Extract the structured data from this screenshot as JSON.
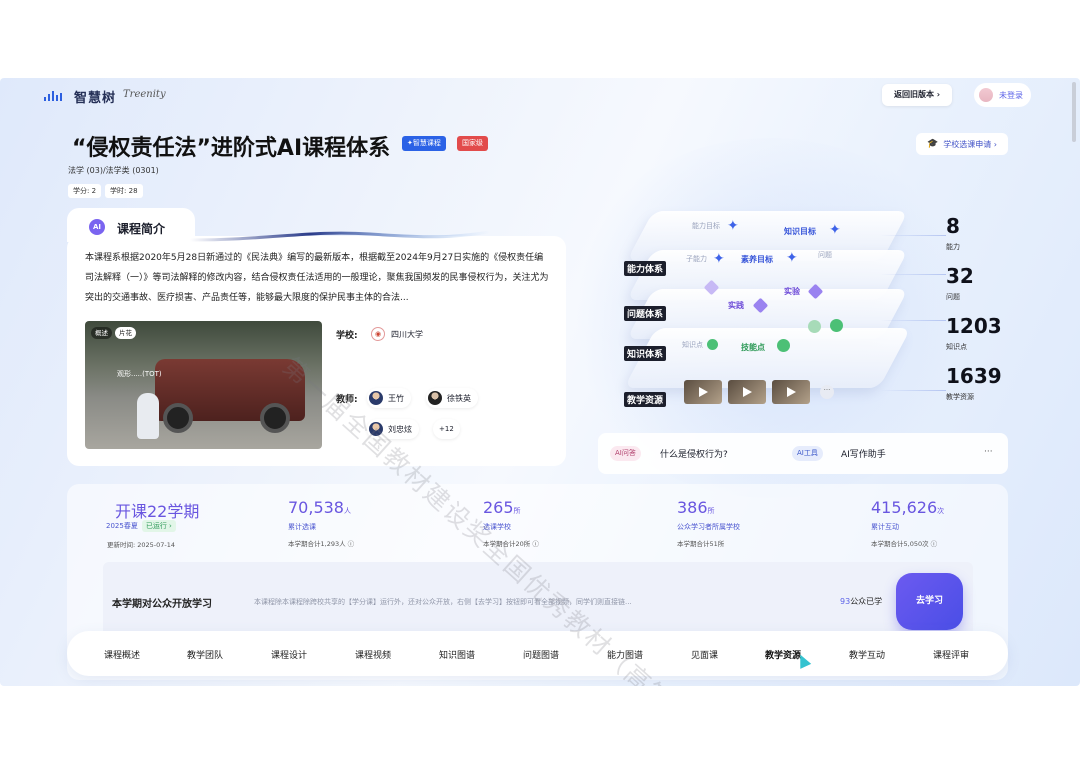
{
  "header": {
    "logo_text": "智慧树",
    "logo_sub": "Treenity",
    "old_version_label": "返回旧版本 ›",
    "login_label": "未登录"
  },
  "course": {
    "title": "“侵权责任法”进阶式AI课程体系",
    "tag_smart": "✦智慧课程",
    "tag_national": "国家级",
    "apply_label": "学校选课申请 ›",
    "subject": "法学 (03)/法学类 (0301)",
    "credit": "学分: 2",
    "hours": "学时: 28"
  },
  "intro": {
    "icon_text": "AI",
    "title": "课程简介",
    "description": "本课程系根据2020年5月28日新通过的《民法典》编写的最新版本，根据截至2024年9月27日实施的《侵权责任编司法解释（一）》等司法解释的修改内容，结合侵权责任法适用的一般理论，聚焦我国频发的民事侵权行为，关注尤为突出的交通事故、医疗损害、产品责任等，能够最大限度的保护民事主体的合法...",
    "video_chip_overview": "概述",
    "video_chip_trailer": "片花",
    "video_caption": "观形.....(TOT)",
    "school_label": "学校:",
    "school_name": "四川大学",
    "teacher_label": "教师:",
    "teachers": [
      "王竹",
      "徐铁英",
      "刘忠炫"
    ],
    "teachers_more": "+12"
  },
  "system": {
    "layers": [
      "能力体系",
      "问题体系",
      "知识体系",
      "教学资源"
    ],
    "nodes": {
      "ability_goal": "能力目标",
      "knowledge_goal": "知识目标",
      "sub_ability": "子能力",
      "quality_goal": "素养目标",
      "question": "问题",
      "practice": "实践",
      "experiment": "实验",
      "knowledge_point": "知识点",
      "skill_point": "技能点"
    },
    "more_resources": "···"
  },
  "metrics": [
    {
      "value": "8",
      "label": "能力"
    },
    {
      "value": "32",
      "label": "问题"
    },
    {
      "value": "1203",
      "label": "知识点"
    },
    {
      "value": "1639",
      "label": "教学资源"
    }
  ],
  "ai_bar": {
    "qa_chip": "AI问答",
    "qa_text": "什么是侵权行为?",
    "tool_chip": "AI工具",
    "tool_text": "AI写作助手",
    "more": "···"
  },
  "stats": {
    "semester": {
      "value": "开课22学期",
      "season": "2025春夏",
      "status": "已运行 ›",
      "updated": "更新时间: 2025-07-14"
    },
    "items": [
      {
        "value": "70,538",
        "unit": "人",
        "label": "累计选课",
        "sub": "本学期合计1,293人 ⓘ"
      },
      {
        "value": "265",
        "unit": "所",
        "label": "选课学校",
        "sub": "本学期合计20所 ⓘ"
      },
      {
        "value": "386",
        "unit": "所",
        "label": "公众学习者所属学校",
        "sub": "本学期合计51所"
      },
      {
        "value": "415,626",
        "unit": "次",
        "label": "累计互动",
        "sub": "本学期合计5,050次 ⓘ"
      }
    ]
  },
  "open_learning": {
    "title": "本学期对公众开放学习",
    "description": "本课程除本课程除跨校共享的【学分课】运行外，还对公众开放，右侧【去学习】按钮即可看全部视频，同学们则直接链...",
    "count": "93",
    "count_suffix": "公众已学",
    "button": "去学习"
  },
  "tabs": [
    "课程概述",
    "教学团队",
    "课程设计",
    "课程视频",
    "知识图谱",
    "问题图谱",
    "能力图谱",
    "见面课",
    "教学资源",
    "教学互动",
    "课程评审"
  ],
  "active_tab": "教学资源",
  "watermark": "第一届全国教材建设奖全国优秀教材（高等教育类）",
  "colors": {
    "accent": "#5c63e8",
    "brand_blue": "#2b62e6",
    "national_red": "#e24b4b",
    "success_green": "#4cc076"
  }
}
